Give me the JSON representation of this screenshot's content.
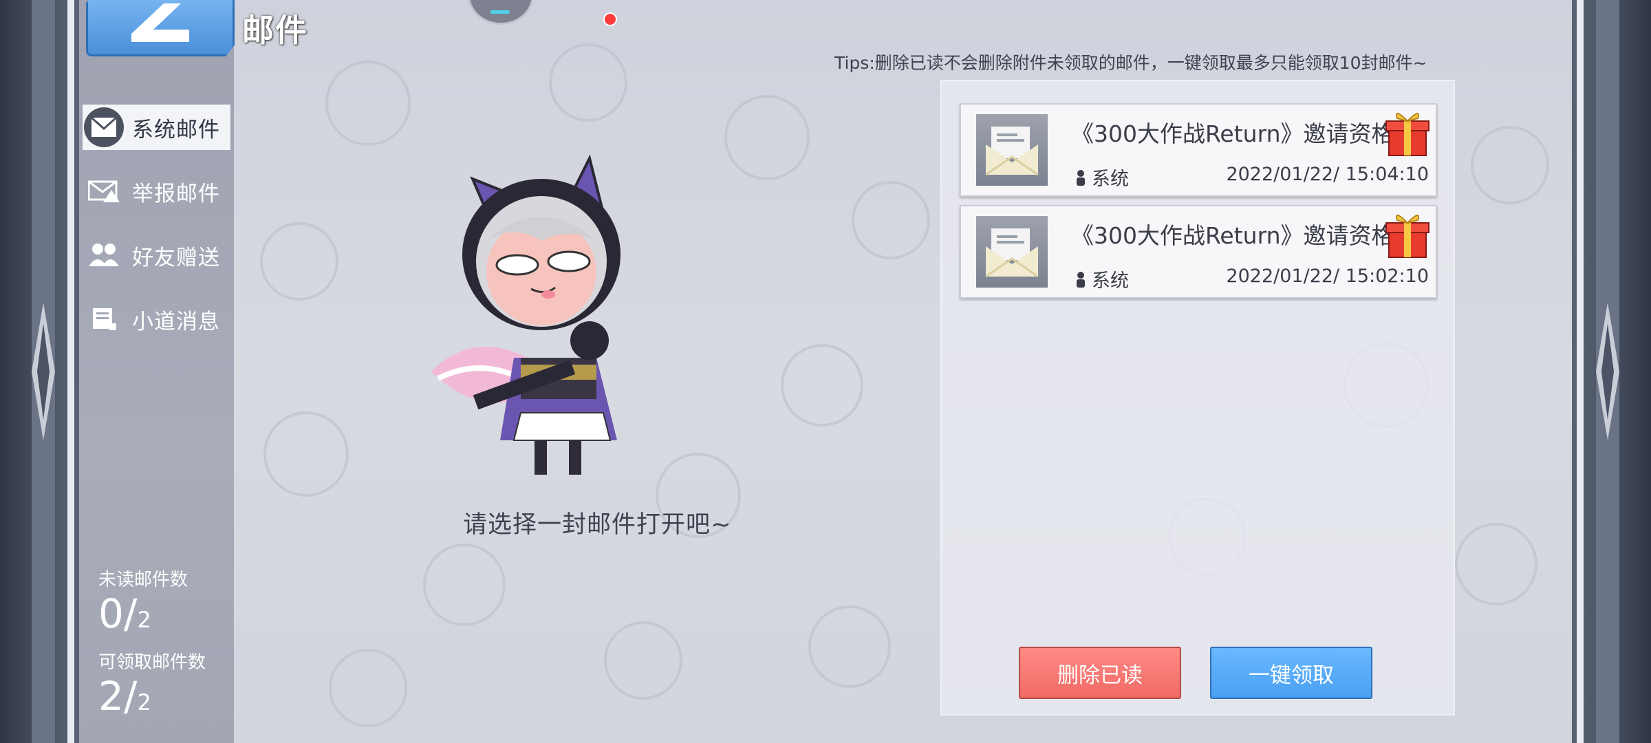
{
  "header": {
    "title": "邮件",
    "back_icon": "back-chevron-icon",
    "notification_color": "#ff3a3a"
  },
  "sidebar": {
    "items": [
      {
        "label": "系统邮件",
        "icon": "mail-icon",
        "active": true
      },
      {
        "label": "举报邮件",
        "icon": "report-mail-icon",
        "active": false
      },
      {
        "label": "好友赠送",
        "icon": "friends-icon",
        "active": false
      },
      {
        "label": "小道消息",
        "icon": "news-icon",
        "active": false
      }
    ],
    "stats": {
      "unread_label": "未读邮件数",
      "unread_count": "0",
      "unread_total": "2",
      "claimable_label": "可领取邮件数",
      "claimable_count": "2",
      "claimable_total": "2"
    }
  },
  "tips": "Tips:删除已读不会删除附件未领取的邮件，一键领取最多只能领取10封邮件~",
  "empty_hint": "请选择一封邮件打开吧~",
  "mails": [
    {
      "subject": "《300大作战Return》邀请资格",
      "sender": "系统",
      "date": "2022/01/22/ 15:04:10",
      "has_attachment": true
    },
    {
      "subject": "《300大作战Return》邀请资格",
      "sender": "系统",
      "date": "2022/01/22/ 15:02:10",
      "has_attachment": true
    }
  ],
  "actions": {
    "delete_read": "删除已读",
    "claim_all": "一键领取"
  },
  "colors": {
    "delete_button": "#f47872",
    "claim_button": "#56aaf8",
    "accent_blue": "#4a8fd9"
  }
}
